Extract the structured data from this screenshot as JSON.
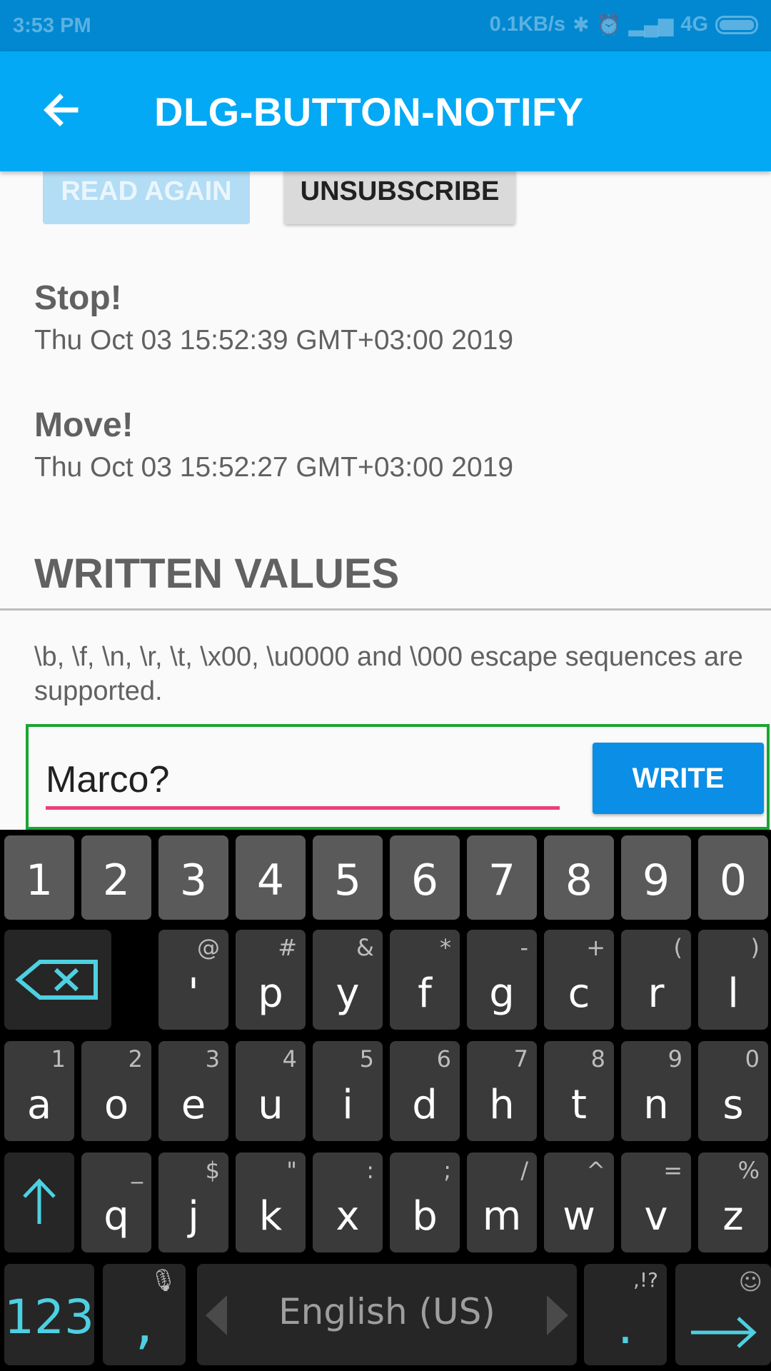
{
  "status_bar": {
    "time": "3:53 PM",
    "network_speed": "0.1KB/s",
    "network_type": "4G"
  },
  "app_bar": {
    "title": "DLG-BUTTON-NOTIFY"
  },
  "buttons": {
    "read_again": "READ AGAIN",
    "unsubscribe": "UNSUBSCRIBE"
  },
  "events": [
    {
      "name": "Stop!",
      "time": "Thu Oct 03 15:52:39 GMT+03:00 2019"
    },
    {
      "name": "Move!",
      "time": "Thu Oct 03 15:52:27 GMT+03:00 2019"
    }
  ],
  "written_values": {
    "title": "WRITTEN VALUES",
    "hint": "\\b, \\f, \\n, \\r, \\t, \\x00, \\u0000 and \\000 escape sequences are supported.",
    "input_value": "Marco?",
    "write_label": "WRITE"
  },
  "keyboard": {
    "row_numbers": [
      "1",
      "2",
      "3",
      "4",
      "5",
      "6",
      "7",
      "8",
      "9",
      "0"
    ],
    "row1": [
      {
        "main": "'",
        "sub": "@"
      },
      {
        "main": "p",
        "sub": "#"
      },
      {
        "main": "y",
        "sub": "&"
      },
      {
        "main": "f",
        "sub": "*"
      },
      {
        "main": "g",
        "sub": "-"
      },
      {
        "main": "c",
        "sub": "+"
      },
      {
        "main": "r",
        "sub": "("
      },
      {
        "main": "l",
        "sub": ")"
      }
    ],
    "row2": [
      {
        "main": "a",
        "sub": "1"
      },
      {
        "main": "o",
        "sub": "2"
      },
      {
        "main": "e",
        "sub": "3"
      },
      {
        "main": "u",
        "sub": "4"
      },
      {
        "main": "i",
        "sub": "5"
      },
      {
        "main": "d",
        "sub": "6"
      },
      {
        "main": "h",
        "sub": "7"
      },
      {
        "main": "t",
        "sub": "8"
      },
      {
        "main": "n",
        "sub": "9"
      },
      {
        "main": "s",
        "sub": "0"
      }
    ],
    "row3": [
      {
        "main": "q",
        "sub": "_"
      },
      {
        "main": "j",
        "sub": "$"
      },
      {
        "main": "k",
        "sub": "\""
      },
      {
        "main": "x",
        "sub": ":"
      },
      {
        "main": "b",
        "sub": ";"
      },
      {
        "main": "m",
        "sub": "/"
      },
      {
        "main": "w",
        "sub": "^"
      },
      {
        "main": "v",
        "sub": "="
      },
      {
        "main": "z",
        "sub": "%"
      }
    ],
    "symbols_label": "123",
    "comma_label": ",",
    "space_label": "English (US)",
    "period_label": ".",
    "period_sub": ",!?",
    "accent_color": "#4dd0e1"
  }
}
